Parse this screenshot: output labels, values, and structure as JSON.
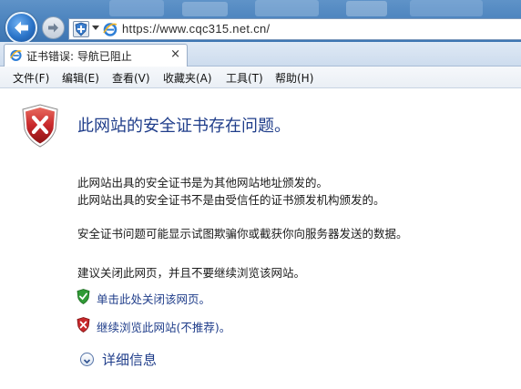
{
  "address_bar": {
    "url": "https://www.cqc315.net.cn/",
    "back_icon": "back-arrow-icon",
    "forward_icon": "forward-arrow-icon",
    "security_icon": "shield-plus-icon",
    "browser_icon": "internet-explorer-icon"
  },
  "tab": {
    "title": "证书错误: 导航已阻止",
    "close": "×"
  },
  "menu": {
    "items": [
      {
        "label": "文件(F)"
      },
      {
        "label": "编辑(E)"
      },
      {
        "label": "查看(V)"
      },
      {
        "label": "收藏夹(A)"
      },
      {
        "label": "工具(T)"
      },
      {
        "label": "帮助(H)"
      }
    ]
  },
  "content": {
    "title": "此网站的安全证书存在问题。",
    "line1": "此网站出具的安全证书是为其他网站地址颁发的。",
    "line2": "此网站出具的安全证书不是由受信任的证书颁发机构颁发的。",
    "line3": "安全证书问题可能显示试图欺骗你或截获你向服务器发送的数据。",
    "line4": "建议关闭此网页，并且不要继续浏览该网站。",
    "close_link": "单击此处关闭该网页。",
    "continue_link": "继续浏览此网站(不推荐)。",
    "details": "详细信息"
  },
  "colors": {
    "link": "#1f3d8a",
    "error_red": "#c8282b",
    "safe_green": "#2f9a35"
  }
}
